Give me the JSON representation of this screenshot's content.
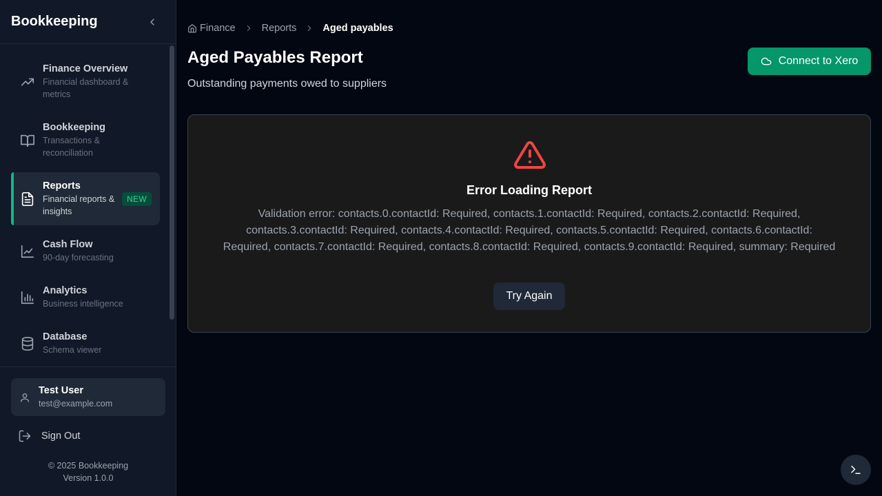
{
  "sidebar": {
    "title": "Bookkeeping",
    "items": [
      {
        "label": "Finance Overview",
        "sub": "Financial dashboard & metrics",
        "icon": "trending-up-icon"
      },
      {
        "label": "Bookkeeping",
        "sub": "Transactions & reconciliation",
        "icon": "book-open-icon"
      },
      {
        "label": "Reports",
        "sub": "Financial reports & insights",
        "icon": "file-text-icon",
        "badge": "NEW",
        "active": true
      },
      {
        "label": "Cash Flow",
        "sub": "90-day forecasting",
        "icon": "line-chart-icon"
      },
      {
        "label": "Analytics",
        "sub": "Business intelligence",
        "icon": "bar-chart-icon"
      },
      {
        "label": "Database",
        "sub": "Schema viewer",
        "icon": "database-icon"
      }
    ],
    "user": {
      "name": "Test User",
      "email": "test@example.com"
    },
    "sign_out": "Sign Out",
    "copyright": "© 2025 Bookkeeping",
    "version": "Version 1.0.0"
  },
  "breadcrumb": [
    "Finance",
    "Reports",
    "Aged payables"
  ],
  "page": {
    "title": "Aged Payables Report",
    "subtitle": "Outstanding payments owed to suppliers",
    "connect_button": "Connect to Xero"
  },
  "error": {
    "title": "Error Loading Report",
    "message": "Validation error: contacts.0.contactId: Required, contacts.1.contactId: Required, contacts.2.contactId: Required, contacts.3.contactId: Required, contacts.4.contactId: Required, contacts.5.contactId: Required, contacts.6.contactId: Required, contacts.7.contactId: Required, contacts.8.contactId: Required, contacts.9.contactId: Required, summary: Required",
    "retry_button": "Try Again"
  },
  "colors": {
    "accent": "#059669",
    "active_bar": "#10b981",
    "error": "#ef4444"
  }
}
